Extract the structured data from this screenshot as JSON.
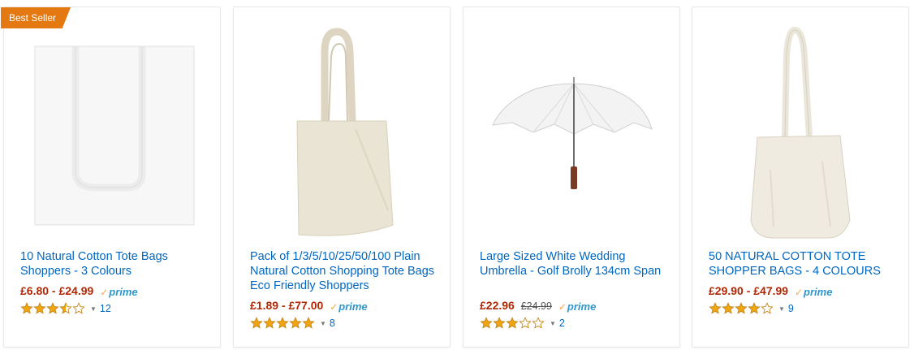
{
  "colors": {
    "link": "#0066c0",
    "price": "#b12704",
    "badge": "#e47911",
    "prime_check": "#f3a847",
    "prime_text": "#2e96c9",
    "star": "#f0a511"
  },
  "products": [
    {
      "badge": "Best Seller",
      "title": "10 Natural Cotton Tote Bags Shoppers - 3 Colours",
      "price": "£6.80 - £24.99",
      "list_price": "",
      "prime": "prime",
      "rating": 3.5,
      "review_count": "12"
    },
    {
      "badge": "",
      "title": "Pack of 1/3/5/10/25/50/100 Plain Natural Cotton Shopping Tote Bags Eco Friendly Shoppers",
      "price": "£1.89 - £77.00",
      "list_price": "",
      "prime": "prime",
      "rating": 5,
      "review_count": "8"
    },
    {
      "badge": "",
      "title": "Large Sized White Wedding Umbrella - Golf Brolly 134cm Span",
      "price": "£22.96",
      "list_price": "£24.99",
      "prime": "prime",
      "rating": 3,
      "review_count": "2"
    },
    {
      "badge": "",
      "title": "50 NATURAL COTTON TOTE SHOPPER BAGS - 4 COLOURS",
      "price": "£29.90 - £47.99",
      "list_price": "",
      "prime": "prime",
      "rating": 4,
      "review_count": "9"
    }
  ]
}
